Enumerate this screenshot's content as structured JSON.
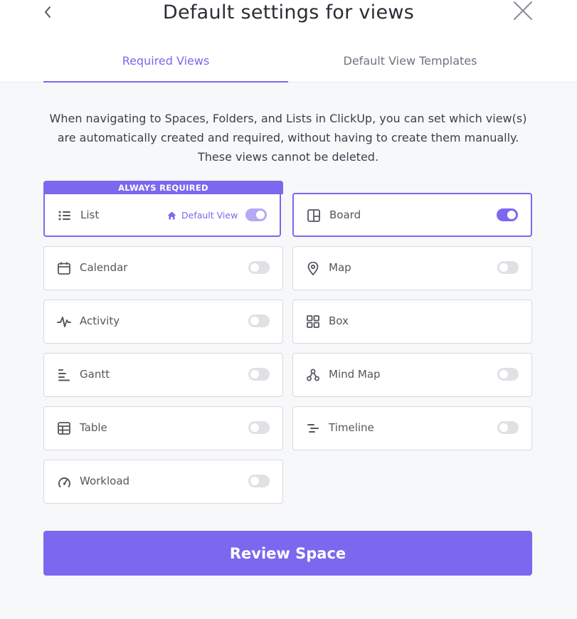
{
  "header": {
    "title": "Default settings for views",
    "back_icon": "chevron-left-icon",
    "close_icon": "close-icon"
  },
  "tabs": [
    {
      "label": "Required Views",
      "active": true
    },
    {
      "label": "Default View Templates",
      "active": false
    }
  ],
  "description": "When navigating to Spaces, Folders, and Lists in ClickUp, you can set which view(s) are automatically created and required, without having to create them manually. These views cannot be deleted.",
  "always_required_label": "ALWAYS REQUIRED",
  "default_view_label": "Default View",
  "views": {
    "list": {
      "label": "List",
      "icon": "list-icon",
      "enabled": true,
      "locked": true
    },
    "board": {
      "label": "Board",
      "icon": "board-icon",
      "enabled": true
    },
    "calendar": {
      "label": "Calendar",
      "icon": "calendar-icon",
      "enabled": false
    },
    "map": {
      "label": "Map",
      "icon": "map-pin-icon",
      "enabled": false
    },
    "activity": {
      "label": "Activity",
      "icon": "activity-icon",
      "enabled": false
    },
    "box": {
      "label": "Box",
      "icon": "box-grid-icon",
      "has_toggle": false
    },
    "gantt": {
      "label": "Gantt",
      "icon": "gantt-icon",
      "enabled": false
    },
    "mind_map": {
      "label": "Mind Map",
      "icon": "mind-map-icon",
      "enabled": false
    },
    "table": {
      "label": "Table",
      "icon": "table-icon",
      "enabled": false
    },
    "timeline": {
      "label": "Timeline",
      "icon": "timeline-icon",
      "enabled": false
    },
    "workload": {
      "label": "Workload",
      "icon": "workload-icon",
      "enabled": false
    }
  },
  "review_button": "Review Space",
  "colors": {
    "accent": "#7b68ee",
    "border": "#d6d9de",
    "text": "#53575e"
  }
}
